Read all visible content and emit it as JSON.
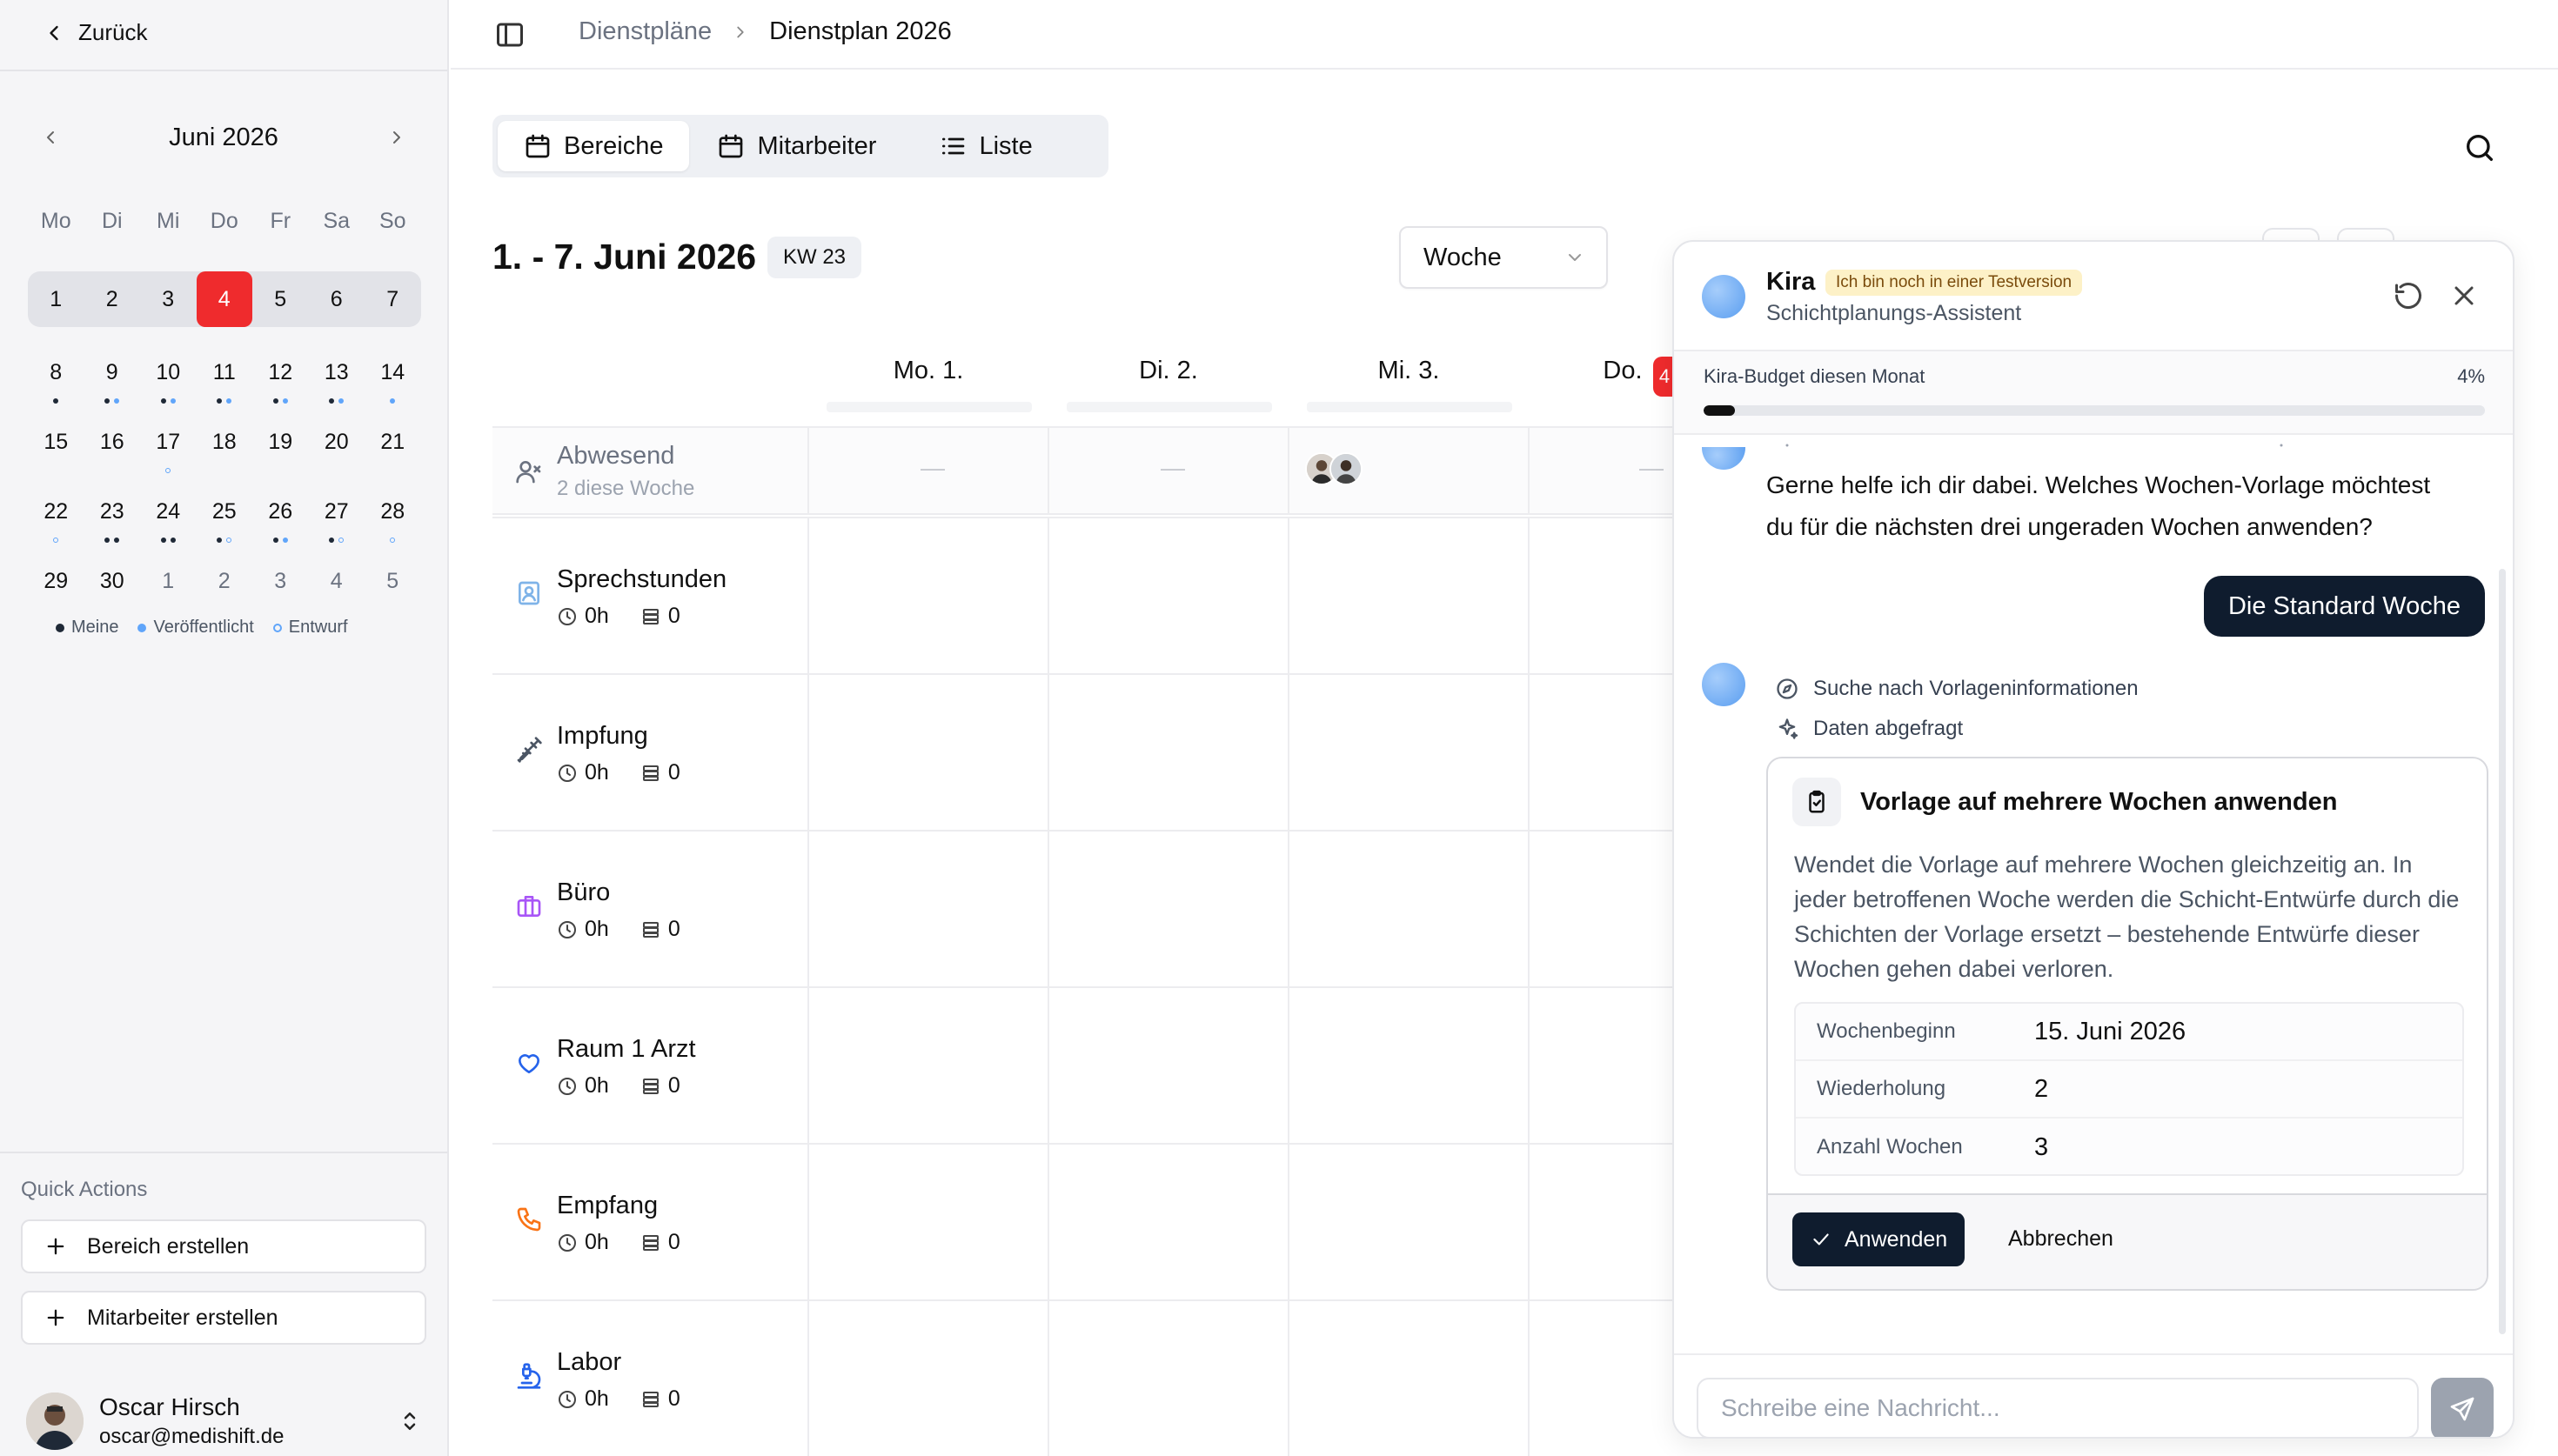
{
  "sidebar": {
    "back_label": "Zurück",
    "calendar": {
      "month_title": "Juni 2026",
      "weekdays": [
        "Mo",
        "Di",
        "Mi",
        "Do",
        "Fr",
        "Sa",
        "So"
      ],
      "weeks": [
        [
          "1",
          "2",
          "3",
          "4",
          "5",
          "6",
          "7"
        ],
        [
          "8",
          "9",
          "10",
          "11",
          "12",
          "13",
          "14"
        ],
        [
          "15",
          "16",
          "17",
          "18",
          "19",
          "20",
          "21"
        ],
        [
          "22",
          "23",
          "24",
          "25",
          "26",
          "27",
          "28"
        ],
        [
          "29",
          "30",
          "1",
          "2",
          "3",
          "4",
          "5"
        ]
      ]
    },
    "legend": {
      "meine": "Meine",
      "veroeffentlicht": "Veröffentlicht",
      "entwurf": "Entwurf"
    },
    "quick_actions": {
      "label": "Quick Actions",
      "create_area": "Bereich erstellen",
      "create_employee": "Mitarbeiter erstellen"
    },
    "user": {
      "name": "Oscar Hirsch",
      "email": "oscar@medishift.de"
    }
  },
  "topbar": {
    "breadcrumb_parent": "Dienstpläne",
    "breadcrumb_current": "Dienstplan 2026"
  },
  "main": {
    "tabs": {
      "bereiche": "Bereiche",
      "mitarbeiter": "Mitarbeiter",
      "liste": "Liste"
    },
    "range_title": "1. - 7. Juni 2026",
    "week_badge": "KW 23",
    "view_select": "Woche",
    "day_headers": [
      "Mo. 1.",
      "Di. 2.",
      "Mi. 3.",
      "Do."
    ],
    "today_marker": "4",
    "absent": {
      "title": "Abwesend",
      "subtitle": "2 diese Woche",
      "dash": "—"
    },
    "areas": [
      {
        "name": "Sprechstunden",
        "hours": "0h",
        "count": "0",
        "icon": "contact-icon",
        "color": "#7fb3e8"
      },
      {
        "name": "Impfung",
        "hours": "0h",
        "count": "0",
        "icon": "syringe-icon",
        "color": "#4b5563"
      },
      {
        "name": "Büro",
        "hours": "0h",
        "count": "0",
        "icon": "briefcase-icon",
        "color": "#a855f7"
      },
      {
        "name": "Raum 1 Arzt",
        "hours": "0h",
        "count": "0",
        "icon": "heart-icon",
        "color": "#2563eb"
      },
      {
        "name": "Empfang",
        "hours": "0h",
        "count": "0",
        "icon": "phone-icon",
        "color": "#f97316"
      },
      {
        "name": "Labor",
        "hours": "0h",
        "count": "0",
        "icon": "microscope-icon",
        "color": "#2563eb"
      }
    ]
  },
  "chat": {
    "assistant_name": "Kira",
    "test_badge": "Ich bin noch in einer Testversion",
    "assistant_subtitle": "Schichtplanungs-Assistent",
    "budget_label": "Kira-Budget diesen Monat",
    "budget_percent_label": "4%",
    "budget_fraction": 0.04,
    "assistant_message": "Gerne helfe ich dir dabei. Welches Wochen-Vorlage möchtest du für die nächsten drei ungeraden Wochen anwenden?",
    "user_message": "Die Standard Woche",
    "tool_steps": [
      "Suche nach Vorlageninformationen",
      "Daten abgefragt"
    ],
    "tool_card": {
      "title": "Vorlage auf mehrere Wochen anwenden",
      "description": "Wendet die Vorlage auf mehrere Wochen gleichzeitig an. In jeder betroffenen Woche werden die Schicht-Entwürfe durch die Schichten der Vorlage ersetzt – bestehende Entwürfe dieser Wochen gehen dabei verloren.",
      "params": [
        {
          "key": "Wochenbeginn",
          "value": "15. Juni 2026"
        },
        {
          "key": "Wiederholung",
          "value": "2"
        },
        {
          "key": "Anzahl Wochen",
          "value": "3"
        }
      ],
      "apply_label": "Anwenden",
      "cancel_label": "Abbrechen"
    },
    "input_placeholder": "Schreibe eine Nachricht..."
  }
}
